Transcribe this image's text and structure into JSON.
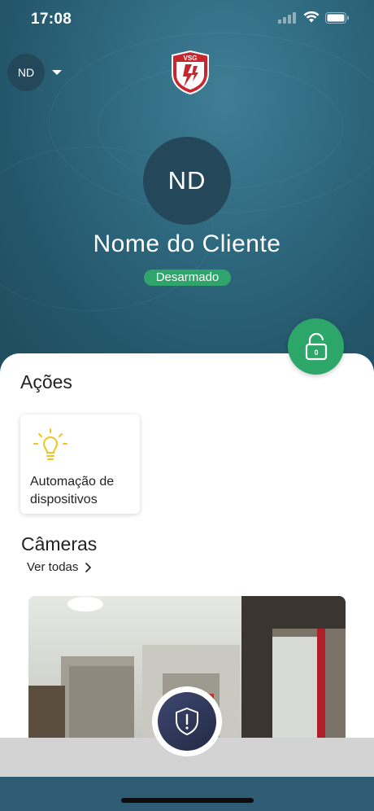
{
  "status_bar": {
    "time": "17:08"
  },
  "header": {
    "user_initials": "ND",
    "logo_text": "VSG"
  },
  "profile": {
    "initials": "ND",
    "client_name": "Nome do Cliente",
    "status": "Desarmado",
    "lock_badge": "0"
  },
  "actions": {
    "title": "Ações",
    "items": [
      {
        "label": "Automação de dispositivos",
        "icon": "lightbulb-icon"
      }
    ]
  },
  "cameras": {
    "title": "Câmeras",
    "see_all": "Ver todas"
  },
  "colors": {
    "accent_green": "#2da66a",
    "hero_blue": "#2d5c73",
    "alarm_navy": "#2e3658",
    "bulb_yellow": "#f2c41b"
  }
}
